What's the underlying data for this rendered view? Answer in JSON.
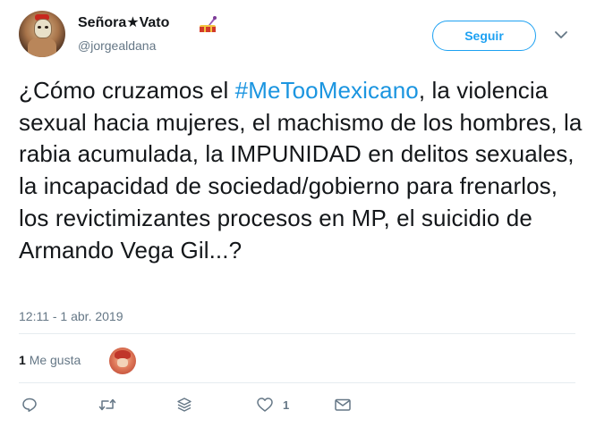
{
  "user": {
    "display_name": "Señora★Vato",
    "handle": "@jorgealdana",
    "follow_label": "Seguir"
  },
  "tweet": {
    "text_before": "¿Cómo cruzamos el ",
    "hashtag": "#MeTooMexicano",
    "text_after": ", la violencia sexual hacia mujeres, el machismo de los hombres, la rabia acumulada, la IMPUNIDAD en delitos sexuales, la incapacidad de sociedad/gobierno para frenarlos, los revictimizantes procesos en MP, el suicidio de Armando Vega Gil...?",
    "timestamp": "12:11 - 1 abr. 2019"
  },
  "stats": {
    "likes_count": "1",
    "likes_label": "Me gusta"
  },
  "actions": {
    "reply_count": "",
    "retweet_count": "",
    "like_count": "1"
  },
  "colors": {
    "accent": "#1da1f2",
    "hashtag": "#1b95e0",
    "muted": "#657786",
    "divider": "#e6ecf0"
  },
  "icons": {
    "reply": "reply-icon",
    "retweet": "retweet-icon",
    "layers": "layers-icon",
    "like": "heart-icon",
    "dm": "envelope-icon",
    "caret": "chevron-down-icon"
  }
}
